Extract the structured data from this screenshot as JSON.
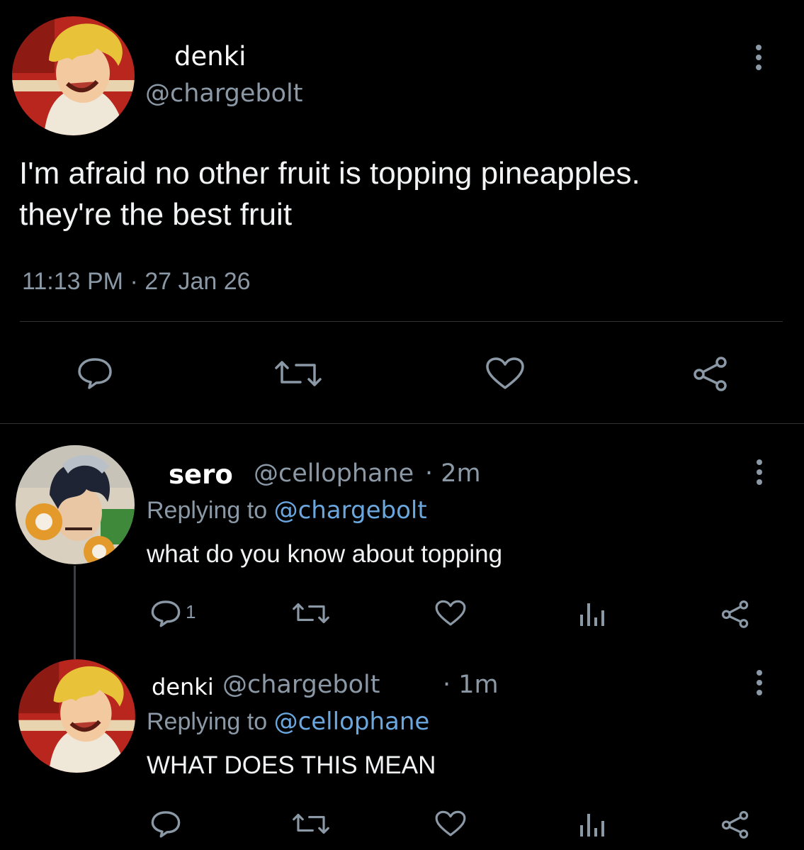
{
  "main_tweet": {
    "author_name": "denki",
    "author_handle": "@chargebolt",
    "text_line1": "I'm afraid no other fruit is topping pineapples.",
    "text_line2": "they're the best fruit",
    "timestamp": "11:13 PM · 27 Jan 26",
    "avatar_icon": "denki-avatar-icon",
    "actions": [
      "reply-icon",
      "retweet-icon",
      "like-icon",
      "share-icon"
    ]
  },
  "reply1": {
    "author_name": "sero",
    "author_handle": "@cellophane",
    "time": "· 2m",
    "replying_prefix": "Replying to",
    "replying_handle": "@chargebolt",
    "text": "what do you know about topping",
    "reply_count": "1",
    "avatar_icon": "sero-avatar-icon"
  },
  "reply2": {
    "author_name": "denki",
    "author_handle": "@chargebolt",
    "time": "· 1m",
    "replying_prefix": "Replying to",
    "replying_handle": "@cellophane",
    "text": "WHAT DOES THIS MEAN",
    "avatar_icon": "denki-avatar-icon"
  },
  "colors": {
    "background": "#000000",
    "text": "#e7e9ea",
    "muted": "#8b98a5",
    "link": "#6aa7df"
  }
}
